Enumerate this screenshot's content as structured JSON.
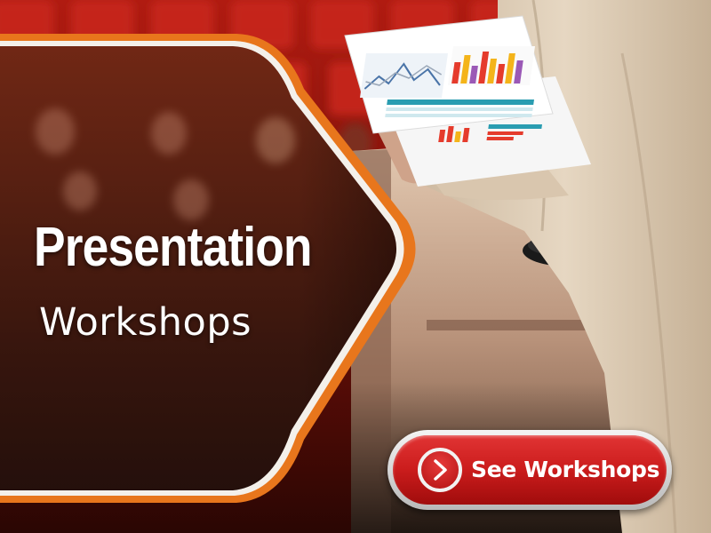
{
  "hero": {
    "title": "Presentation",
    "subtitle": "Workshops"
  },
  "cta": {
    "label": "See Workshops",
    "icon": "chevron-right-icon"
  },
  "colors": {
    "accent_orange": "#e8761c",
    "cta_red": "#cc1d1d",
    "panel_brown": "#4a1608",
    "seat_red": "#a51a12"
  }
}
